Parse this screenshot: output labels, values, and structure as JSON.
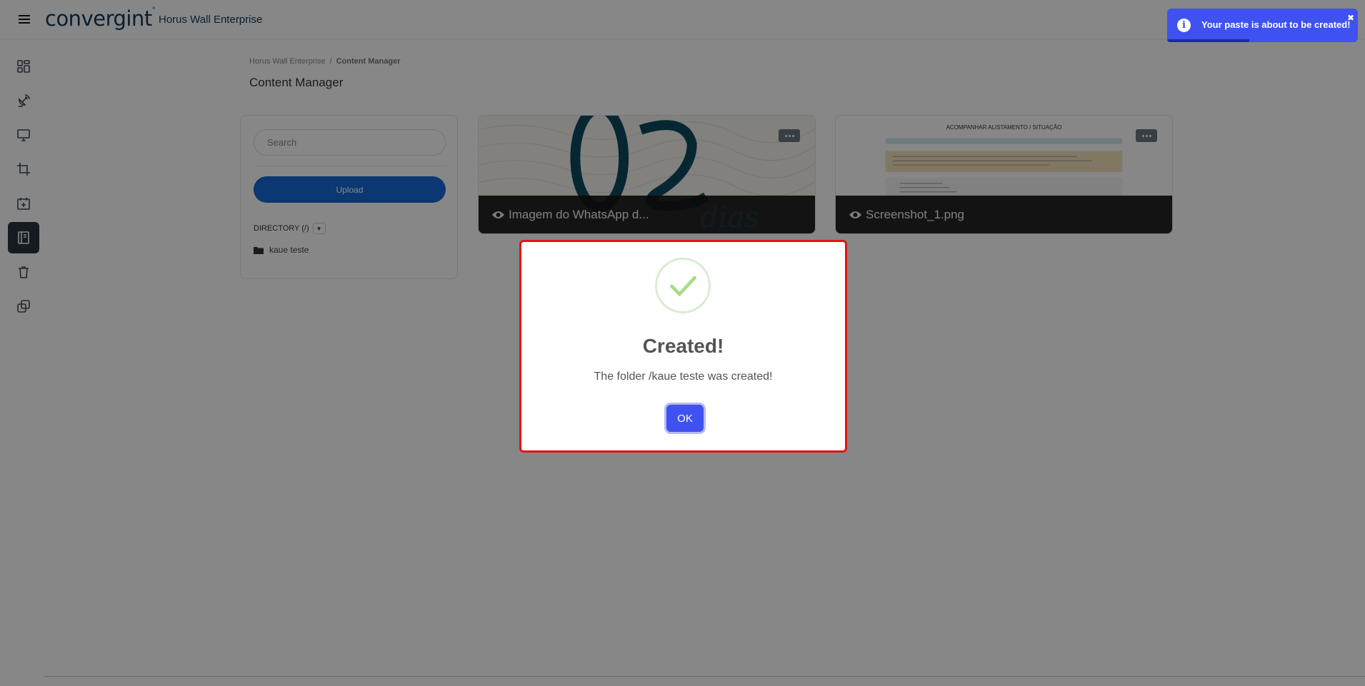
{
  "header": {
    "brand": "convergint",
    "app_title": "Horus Wall Enterprise"
  },
  "sidebar": {
    "items": [
      {
        "icon": "dashboard-icon"
      },
      {
        "icon": "satellite-dish-icon"
      },
      {
        "icon": "monitor-icon"
      },
      {
        "icon": "crop-icon"
      },
      {
        "icon": "calendar-add-icon"
      },
      {
        "icon": "content-manager-icon",
        "active": true
      },
      {
        "icon": "trash-icon"
      },
      {
        "icon": "copy-icon"
      }
    ]
  },
  "breadcrumb": {
    "root": "Horus Wall Enterprise",
    "separator": "/",
    "current": "Content Manager"
  },
  "page": {
    "title": "Content Manager"
  },
  "panel": {
    "search_placeholder": "Search",
    "upload_label": "Upload",
    "directory_label": "DIRECTORY (/)",
    "folders": [
      "kaue teste"
    ]
  },
  "cards": [
    {
      "name": "Imagem do WhatsApp d...",
      "thumb_text": "dias"
    },
    {
      "name": "Screenshot_1.png",
      "thumb_heading": "ACOMPANHAR ALISTAMENTO / SITUAÇÃO"
    }
  ],
  "modal": {
    "title": "Created!",
    "message": "The folder /kaue teste was created!",
    "ok_label": "OK",
    "accent": "#3f51f0",
    "border_color": "#e01414"
  },
  "toast": {
    "message": "Your paste is about to be created!",
    "close": "✖",
    "color": "#3f51f0"
  }
}
